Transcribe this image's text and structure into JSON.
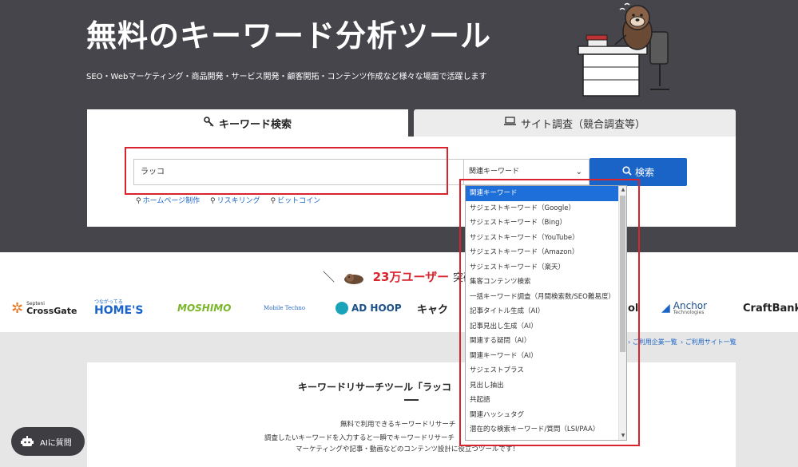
{
  "hero": {
    "title": "無料のキーワード分析ツール",
    "subtitle": "SEO・Webマーケティング・商品開発・サービス開発・顧客開拓・コンテンツ作成など様々な場面で活躍します"
  },
  "tabs": [
    {
      "label": "キーワード検索",
      "icon": "key-icon",
      "active": true
    },
    {
      "label": "サイト調査（競合調査等）",
      "icon": "laptop-icon",
      "active": false
    }
  ],
  "search": {
    "value": "ラッコ",
    "select_value": "関連キーワード",
    "button_label": "検索"
  },
  "suggestions": [
    "ホームページ制作",
    "リスキリング",
    "ビットコイン"
  ],
  "dropdown": {
    "options": [
      "関連キーワード",
      "サジェストキーワード（Google）",
      "サジェストキーワード（Bing）",
      "サジェストキーワード（YouTube）",
      "サジェストキーワード（Amazon）",
      "サジェストキーワード（楽天）",
      "集客コンテンツ検索",
      "一括キーワード調査（月間検索数/SEO難易度）",
      "記事タイトル生成（AI）",
      "記事見出し生成（AI）",
      "関連する疑問（AI）",
      "関連キーワード（AI）",
      "サジェストプラス",
      "見出し抽出",
      "共起語",
      "関連ハッシュタグ",
      "潜在的な検索キーワード/質問（LSI/PAA）"
    ],
    "selected_index": 0
  },
  "users": {
    "prefix": "＼",
    "count": "23万ユーザー",
    "suffix": "突破"
  },
  "logos": [
    "CrossGate",
    "HOME'S",
    "MOSHIMO",
    "Mobile Techno",
    "AD HOOP",
    "キャク",
    "ol",
    "Anchor",
    "CraftBank"
  ],
  "logo_sublabels": {
    "crossgate": "Septeni",
    "homes": "つながってる",
    "anchor": "Technologies"
  },
  "links": {
    "companies": "ご利用企業一覧",
    "sites": "ご利用サイト一覧"
  },
  "card": {
    "title": "キーワードリサーチツール「ラッコ",
    "line1": "無料で利用できるキーワードリサーチ",
    "line2": "調査したいキーワードを入力すると一瞬でキーワードリサーチ",
    "line3": "マーケティングや記事・動画などのコンテンツ設計に役立つツールです！"
  },
  "ai_button": {
    "label": "AIに質問"
  },
  "colors": {
    "hero_bg": "#46454b",
    "accent_blue": "#1a64c8",
    "highlight_red": "#d9232d"
  }
}
